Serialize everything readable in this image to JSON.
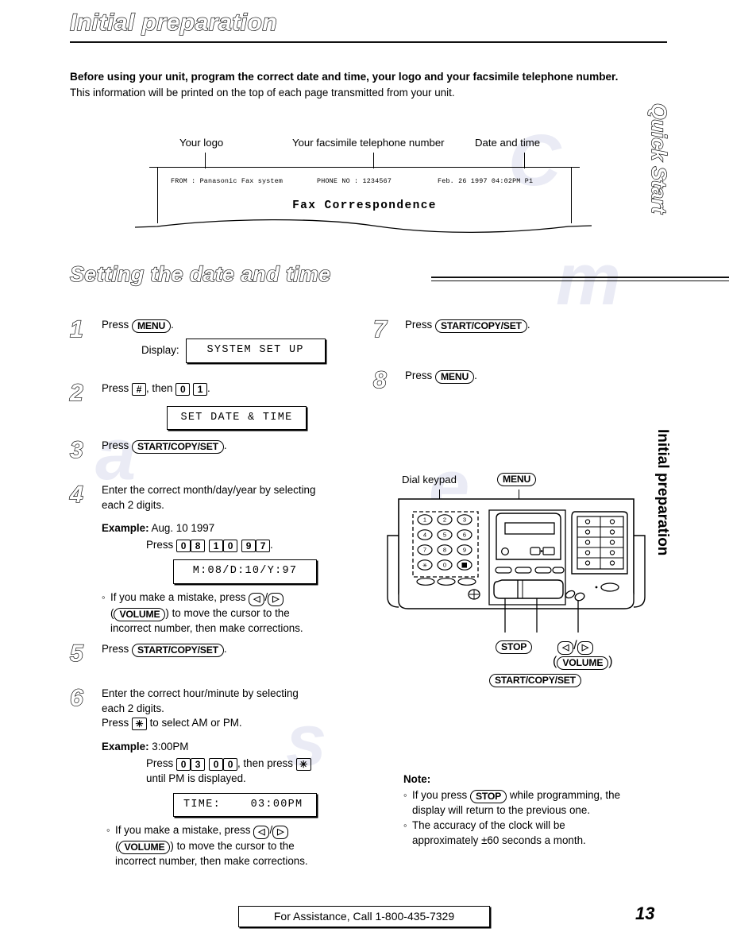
{
  "chapter": {
    "title": "Initial preparation"
  },
  "intro": {
    "bold_line": "Before using your unit, program the correct date and time, your logo and your facsimile telephone number.",
    "plain_line": "This information will be printed on the top of each page transmitted from your unit."
  },
  "fax_sample": {
    "callouts": {
      "logo": "Your logo",
      "phone": "Your facsimile telephone number",
      "datetime": "Date and time"
    },
    "header_from": "FROM : Panasonic Fax system",
    "header_phone": "PHONE NO : 1234567",
    "header_datetime": "Feb. 26 1997 04:02PM P1",
    "body_text": "Fax Correspondence"
  },
  "section": {
    "title": "Setting the date and time"
  },
  "steps": [
    {
      "num": "1",
      "text_prefix": "Press",
      "key": "MENU",
      "text_suffix": ".",
      "display_label": "Display:",
      "lcd": "SYSTEM SET UP"
    },
    {
      "num": "2",
      "text_prefix": "Press",
      "key_hash": "#",
      "text_mid": ", then",
      "key_0": "0",
      "key_1": "1",
      "text_suffix": ".",
      "lcd": "SET DATE & TIME"
    },
    {
      "num": "3",
      "text_prefix": "Press",
      "key": "START/COPY/SET",
      "text_suffix": "."
    },
    {
      "num": "4",
      "line1": "Enter the correct month/day/year by selecting",
      "line2": "each 2 digits.",
      "example_label": "Example:",
      "example_value": "Aug. 10 1997",
      "press_label": "Press",
      "digits": [
        "0",
        "8",
        "1",
        "0",
        "9",
        "7"
      ],
      "press_suffix": ".",
      "lcd": "M:08/D:10/Y:97",
      "mistake_line1": "If you make a mistake, press",
      "arrow_left": "◁",
      "arrow_right": "▷",
      "arrow_sep": "/",
      "volume_key": "VOLUME",
      "mistake_line2_pre": "(",
      "mistake_line2_post": ") to move the cursor to the",
      "mistake_line3": "incorrect number, then make corrections."
    },
    {
      "num": "5",
      "text_prefix": "Press",
      "key": "START/COPY/SET",
      "text_suffix": "."
    },
    {
      "num": "6",
      "line1": "Enter the correct hour/minute by selecting",
      "line2": "each 2 digits.",
      "line3_pre": "Press",
      "star_key": "✳",
      "line3_post": "to select AM or PM.",
      "example_label": "Example:",
      "example_value": "3:00PM",
      "press_label": "Press",
      "digits": [
        "0",
        "3",
        "0",
        "0"
      ],
      "press_mid": ", then press",
      "press_after": "until PM is displayed.",
      "lcd": "TIME:    03:00PM",
      "mistake_line1": "If you make a mistake, press",
      "volume_key": "VOLUME",
      "mistake_line2_post": ") to move the cursor to the",
      "mistake_line3": "incorrect number, then make corrections."
    },
    {
      "num": "7",
      "text_prefix": "Press",
      "key": "START/COPY/SET",
      "text_suffix": "."
    },
    {
      "num": "8",
      "text_prefix": "Press",
      "key": "MENU",
      "text_suffix": "."
    }
  ],
  "machine": {
    "label_dial_keypad": "Dial keypad",
    "label_menu": "MENU",
    "label_stop": "STOP",
    "label_arrow_left": "◁",
    "label_arrow_right": "▷",
    "label_volume": "VOLUME",
    "label_start_copy_set": "START/COPY/SET",
    "keypad_keys": [
      "1",
      "2",
      "3",
      "4",
      "5",
      "6",
      "7",
      "8",
      "9",
      "✳",
      "0",
      "■"
    ]
  },
  "note": {
    "title": "Note:",
    "items": [
      {
        "pre": "If you press",
        "key": "STOP",
        "post": "while programming, the",
        "line2": "display will return to the previous one."
      },
      {
        "line1": "The accuracy of the clock will be",
        "line2": "approximately ±60 seconds a month."
      }
    ]
  },
  "footer": {
    "assistance": "For Assistance, Call 1-800-435-7329",
    "page_number": "13"
  },
  "side_tabs": {
    "quick_start": "Quick Start",
    "initial_preparation": "Initial preparation"
  }
}
